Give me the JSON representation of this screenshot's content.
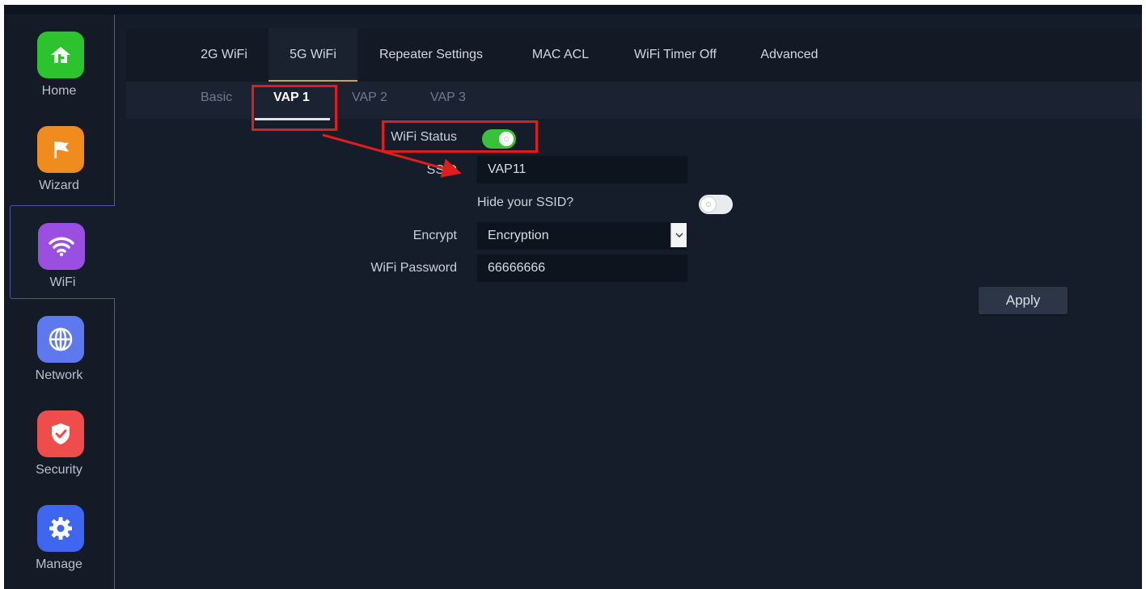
{
  "sidebar": {
    "items": [
      {
        "label": "Home",
        "icon": "home-icon",
        "color": "#2cc32f"
      },
      {
        "label": "Wizard",
        "icon": "flag-icon",
        "color": "#f08b1e"
      },
      {
        "label": "WiFi",
        "icon": "wifi-icon",
        "color": "#9a4fe0",
        "active": true
      },
      {
        "label": "Network",
        "icon": "globe-icon",
        "color": "#5e78ee"
      },
      {
        "label": "Security",
        "icon": "shield-icon",
        "color": "#ef4c4c"
      },
      {
        "label": "Manage",
        "icon": "gear-icon",
        "color": "#3f66ee"
      }
    ]
  },
  "tabs": {
    "items": [
      "2G WiFi",
      "5G WiFi",
      "Repeater Settings",
      "MAC ACL",
      "WiFi Timer Off",
      "Advanced"
    ],
    "active": "5G WiFi"
  },
  "subtabs": {
    "items": [
      "Basic",
      "VAP 1",
      "VAP 2",
      "VAP 3"
    ],
    "active": "VAP 1"
  },
  "form": {
    "wifi_status_label": "WiFi Status",
    "wifi_status_on": true,
    "ssid_label": "SSID",
    "ssid_value": "VAP11",
    "hide_ssid_label": "Hide your SSID?",
    "hide_ssid_on": false,
    "encrypt_label": "Encrypt",
    "encrypt_value": "Encryption",
    "password_label": "WiFi Password",
    "password_value": "66666666",
    "apply_label": "Apply"
  },
  "colors": {
    "toggle_on": "#39c239",
    "toggle_off": "#e9ecef",
    "annotation": "#e01c1c",
    "tab_active_underline": "#c9a45c"
  }
}
